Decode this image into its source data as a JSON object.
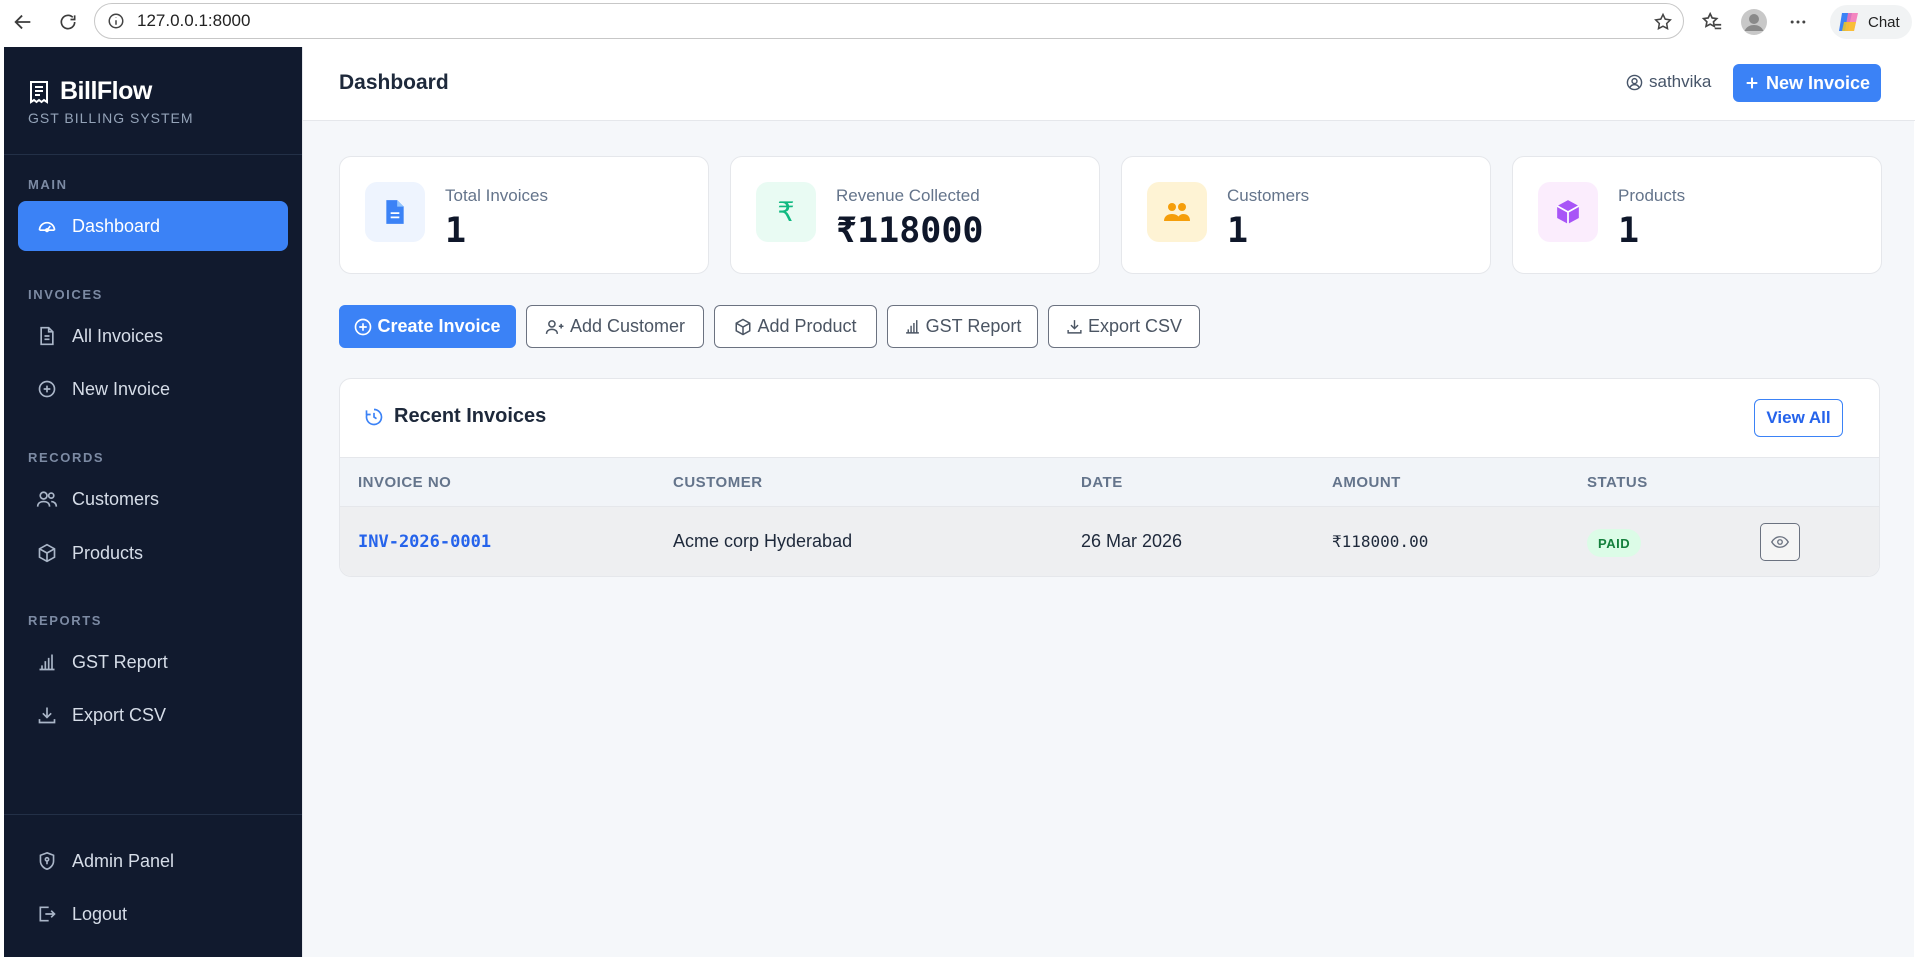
{
  "browser": {
    "url": "127.0.0.1:8000",
    "chat_label": "Chat"
  },
  "sidebar": {
    "brand_name": "BillFlow",
    "brand_subtitle": "GST BILLING SYSTEM",
    "sections": {
      "main": "MAIN",
      "invoices": "INVOICES",
      "records": "RECORDS",
      "reports": "REPORTS"
    },
    "items": {
      "dashboard": "Dashboard",
      "all_invoices": "All Invoices",
      "new_invoice": "New Invoice",
      "customers": "Customers",
      "products": "Products",
      "gst_report": "GST Report",
      "export_csv": "Export CSV",
      "admin_panel": "Admin Panel",
      "logout": "Logout"
    }
  },
  "header": {
    "title": "Dashboard",
    "username": "sathvika",
    "new_invoice_label": "New Invoice"
  },
  "stats": [
    {
      "label": "Total Invoices",
      "value": "1",
      "icon": "file-icon",
      "color": "#3b82f6"
    },
    {
      "label": "Revenue Collected",
      "value": "₹118000",
      "icon": "rupee-icon",
      "color": "#10b981"
    },
    {
      "label": "Customers",
      "value": "1",
      "icon": "users-icon",
      "color": "#f59e0b"
    },
    {
      "label": "Products",
      "value": "1",
      "icon": "box-icon",
      "color": "#a855f7"
    }
  ],
  "actions": {
    "create_invoice": "Create Invoice",
    "add_customer": "Add Customer",
    "add_product": "Add Product",
    "gst_report": "GST Report",
    "export_csv": "Export CSV"
  },
  "recent": {
    "title": "Recent Invoices",
    "view_all": "View All",
    "columns": [
      "INVOICE NO",
      "CUSTOMER",
      "DATE",
      "AMOUNT",
      "STATUS"
    ],
    "rows": [
      {
        "invoice_no": "INV-2026-0001",
        "customer": "Acme corp Hyderabad",
        "date": "26 Mar 2026",
        "amount": "₹118000.00",
        "status": "PAID"
      }
    ]
  }
}
